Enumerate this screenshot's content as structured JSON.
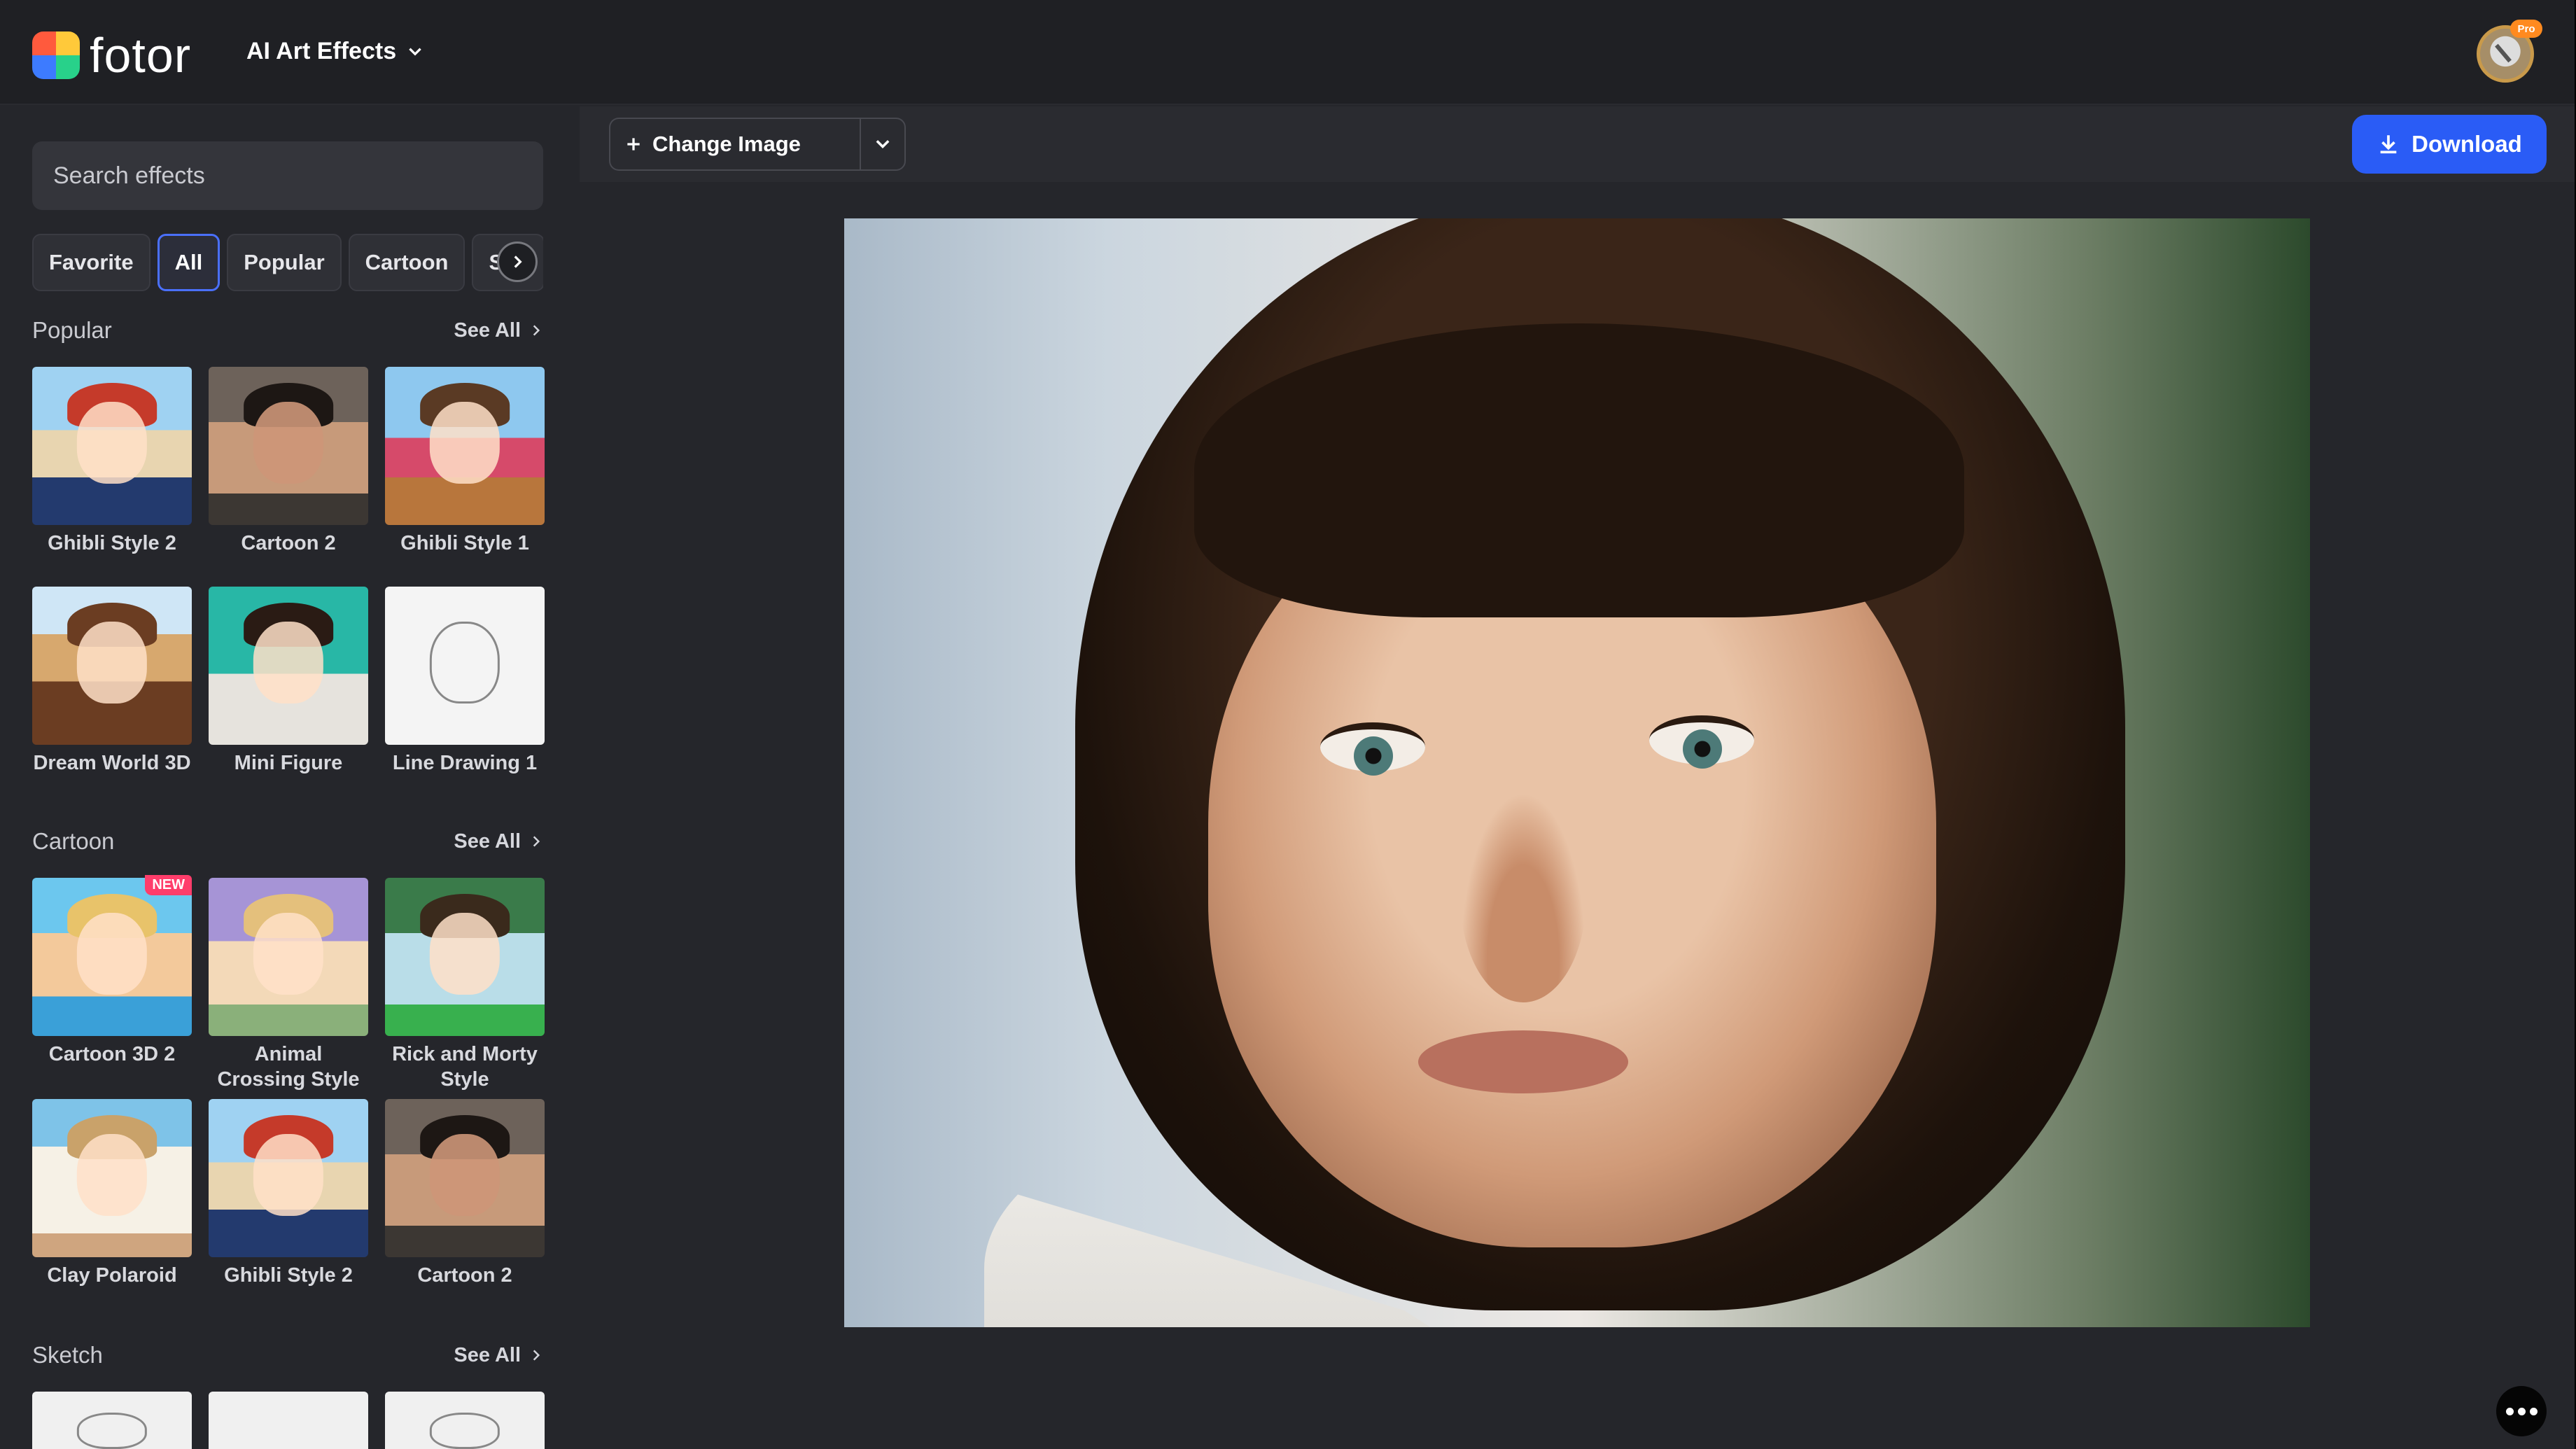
{
  "header": {
    "logo_text": "fotor",
    "menu_title": "AI Art Effects",
    "pro_badge": "Pro"
  },
  "sidebar": {
    "search_placeholder": "Search effects",
    "filters": [
      "Favorite",
      "All",
      "Popular",
      "Cartoon",
      "Ske"
    ],
    "active_filter": "All",
    "see_all_label": "See All",
    "sections": {
      "popular": {
        "title": "Popular",
        "items": [
          "Ghibli Style 2",
          "Cartoon 2",
          "Ghibli Style 1",
          "Dream World 3D",
          "Mini Figure",
          "Line Drawing 1"
        ]
      },
      "cartoon": {
        "title": "Cartoon",
        "new_badge": "NEW",
        "items": [
          "Cartoon 3D 2",
          "Animal Crossing Style",
          "Rick and Morty Style",
          "Clay Polaroid",
          "Ghibli Style 2",
          "Cartoon 2"
        ]
      },
      "sketch": {
        "title": "Sketch"
      }
    }
  },
  "toolbar": {
    "change_image_label": "Change Image",
    "download_label": "Download"
  },
  "colors": {
    "accent": "#2a5cf6",
    "active_chip_border": "#4a70ff",
    "background": "#25262b",
    "new_badge": "#ff3d6b"
  },
  "icons": [
    "chevron-down-icon",
    "chevron-right-icon",
    "plus-icon",
    "download-icon",
    "more-dots-icon"
  ]
}
